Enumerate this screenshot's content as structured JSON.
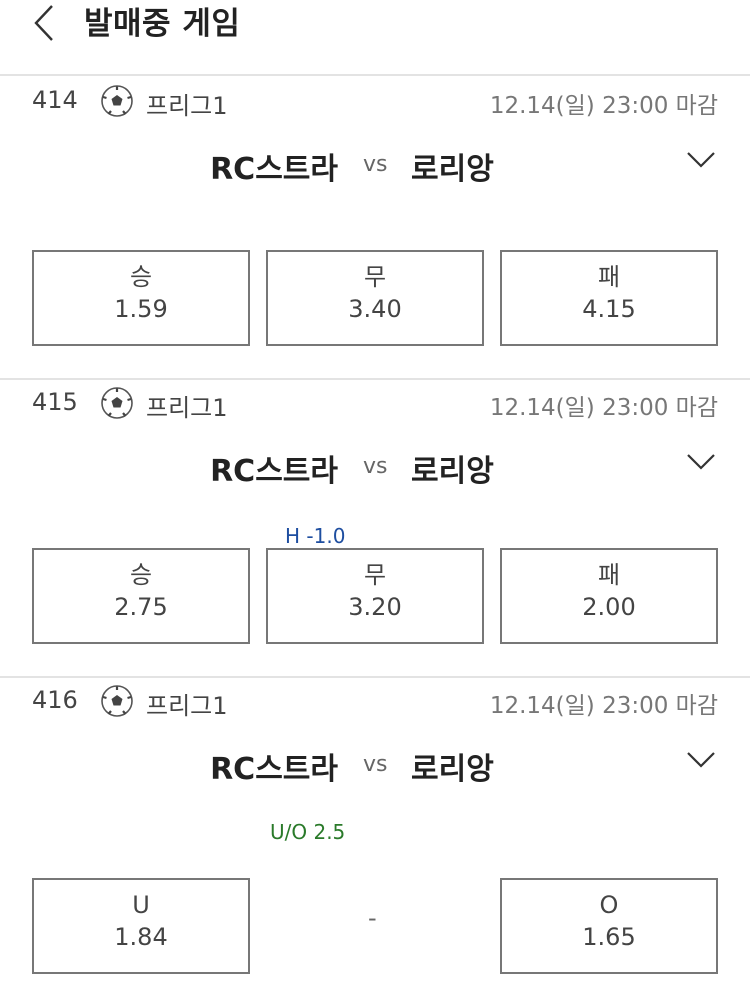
{
  "header": {
    "title": "발매중 게임"
  },
  "games": [
    {
      "no": "414",
      "league": "프리그1",
      "deadline": "12.14(일) 23:00 마감",
      "home": "RC스트라",
      "vs": "vs",
      "away": "로리앙",
      "note": "",
      "odds": [
        {
          "label": "승",
          "value": "1.59"
        },
        {
          "label": "무",
          "value": "3.40"
        },
        {
          "label": "패",
          "value": "4.15"
        }
      ]
    },
    {
      "no": "415",
      "league": "프리그1",
      "deadline": "12.14(일) 23:00 마감",
      "home": "RC스트라",
      "vs": "vs",
      "away": "로리앙",
      "note": "H -1.0",
      "odds": [
        {
          "label": "승",
          "value": "2.75"
        },
        {
          "label": "무",
          "value": "3.20"
        },
        {
          "label": "패",
          "value": "2.00"
        }
      ]
    },
    {
      "no": "416",
      "league": "프리그1",
      "deadline": "12.14(일) 23:00 마감",
      "home": "RC스트라",
      "vs": "vs",
      "away": "로리앙",
      "note": "U/O 2.5",
      "middle": "-",
      "odds": [
        {
          "label": "U",
          "value": "1.84"
        },
        {
          "label": "O",
          "value": "1.65"
        }
      ]
    }
  ],
  "icons": {
    "back": "chevron-left-icon",
    "sport": "soccer-ball-icon",
    "expand": "chevron-down-icon"
  },
  "colors": {
    "handicap": "#1e4ea0",
    "under_over": "#2a7a2a",
    "divider": "#e3e3e3"
  }
}
